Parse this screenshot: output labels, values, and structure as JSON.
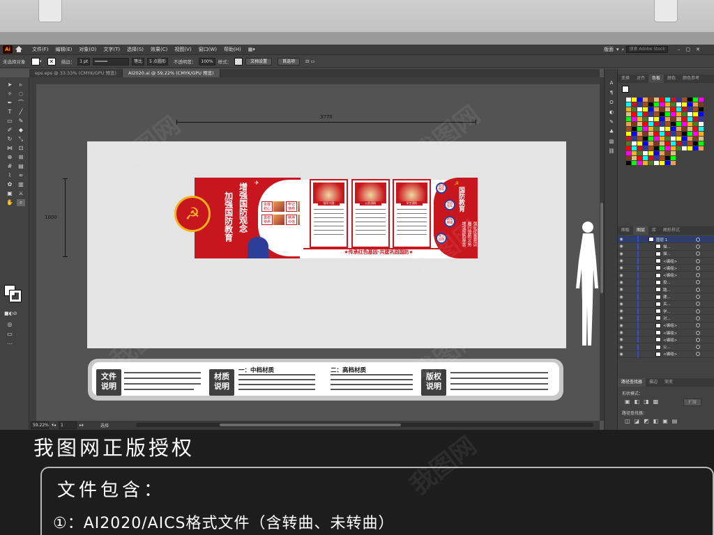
{
  "app": {
    "menus": [
      "文件(F)",
      "编辑(E)",
      "对象(O)",
      "文字(T)",
      "选择(S)",
      "效果(C)",
      "视图(V)",
      "窗口(W)",
      "帮助(H)"
    ],
    "workspace": "版面",
    "search_placeholder": "搜索 Adobe Stock"
  },
  "control_bar": {
    "selection": "未选择对象",
    "stroke_label": "描边：",
    "stroke_value": "1 pt",
    "profile": "等比",
    "brush": "5 点圆形",
    "opacity_label": "不透明度：",
    "opacity_value": "100%",
    "style_label": "样式：",
    "doc_setup": "文档设置",
    "preferences": "首选项"
  },
  "tabs": [
    {
      "label": "eps.eps @ 33.33% (CMYK/GPU 预览)"
    },
    {
      "label": "AI2020.ai @ 59.22% (CMYK/GPU 预览)"
    }
  ],
  "artboard": {
    "width_dim": "3770",
    "height_dim": "1000",
    "slogan_line1": "增强国防观念",
    "slogan_line2": "加强国防教育",
    "badges": [
      "永葆初心",
      "牢记使命",
      "勇担使命",
      "精神价值"
    ],
    "panel_titles": [
      "强军兴国",
      "公民国防",
      "学生国防"
    ],
    "bottom_slogan": "★传承红色基因·共建巩固国防★",
    "right_title": "国防教育",
    "right_circles": [
      "爱国拥军",
      "强国强军",
      "拥军拥属",
      "保卫国防"
    ],
    "right_lines": [
      "增强国防观念",
      "履行国防义务",
      "强化忧患意识"
    ]
  },
  "info_card": {
    "file_label": [
      "文件",
      "说明"
    ],
    "material_label": [
      "材质",
      "说明"
    ],
    "copyright_label": [
      "版权",
      "说明"
    ],
    "mid_heading": "一：中档材质",
    "high_heading": "二：高档材质"
  },
  "status": {
    "zoom": "59.22%",
    "page": "1",
    "tool": "选择"
  },
  "right_panel": {
    "top_tabs": [
      "变换",
      "对齐",
      "色板",
      "颜色",
      "颜色参考"
    ],
    "layers_tabs": [
      "图板",
      "图层",
      "库",
      "图形样式"
    ],
    "layers": [
      "图层 1",
      "描...",
      "描...",
      "<编组>",
      "<编组>",
      "<编组>",
      "投...",
      "路...",
      "建...",
      "关...",
      "学...",
      "对...",
      "<编组>",
      "<编组>",
      "<编组>",
      "公...",
      "<编组>"
    ],
    "pathfinder_tabs": [
      "路径查找器",
      "描边",
      "渐变"
    ],
    "shape_mode": "形状模式：",
    "pathfinder_label": "路径查找器：",
    "expand": "扩展"
  },
  "banner": {
    "title": "我图网正版授权",
    "contains": "文件包含：",
    "format_line": "①：AI2020/AICS格式文件（含转曲、未转曲）",
    "watermark": "我图网"
  },
  "colors": {
    "party_red": "#c8161e",
    "gold": "#f5b21a",
    "navy": "#2c3e98",
    "ui_dark": "#424242"
  }
}
